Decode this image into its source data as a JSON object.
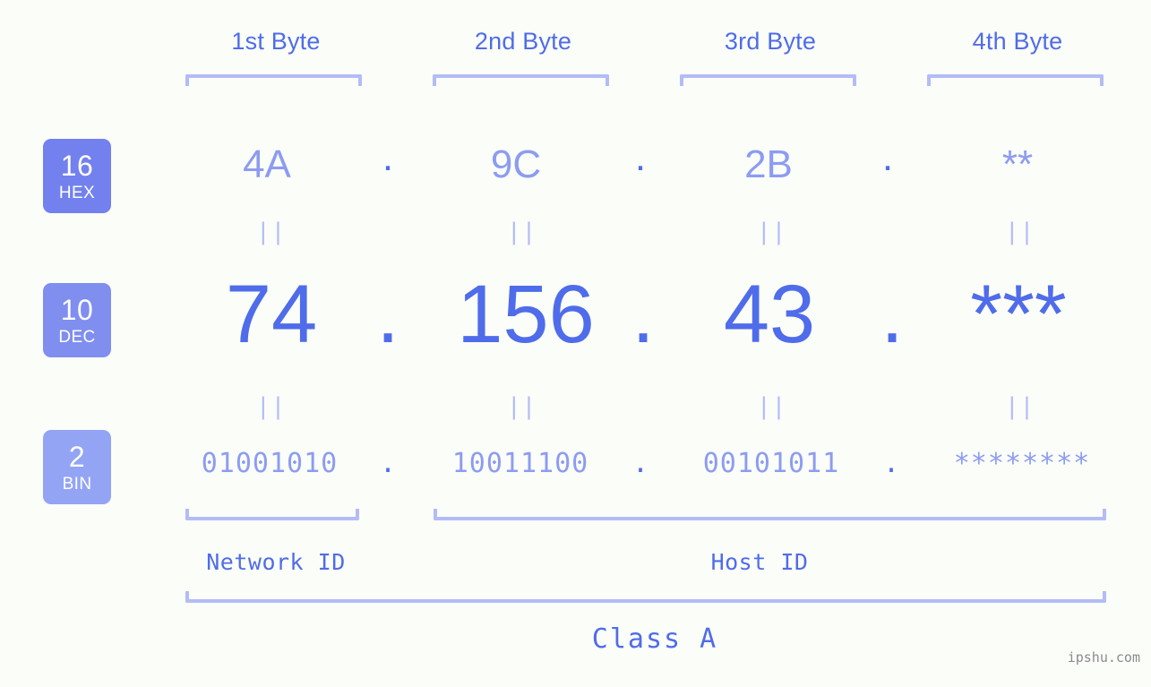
{
  "watermark": "ipshu.com",
  "colors": {
    "background": "#fbfdf8",
    "accent_strong": "#4f6cea",
    "accent_light": "#8c9cf2",
    "bracket": "#b3bcf7",
    "badge_hex": "#7281ed",
    "badge_dec": "#7f8eef",
    "badge_bin": "#93a4f5",
    "watermark": "#8b8b8b"
  },
  "byte_headers": [
    {
      "label": "1st Byte"
    },
    {
      "label": "2nd Byte"
    },
    {
      "label": "3rd Byte"
    },
    {
      "label": "4th Byte"
    }
  ],
  "bases": [
    {
      "num": "16",
      "name": "HEX"
    },
    {
      "num": "10",
      "name": "DEC"
    },
    {
      "num": "2",
      "name": "BIN"
    }
  ],
  "rows": {
    "hex": {
      "values": [
        "4A",
        "9C",
        "2B",
        "**"
      ],
      "separator": "."
    },
    "dec": {
      "values": [
        "74",
        "156",
        "43",
        "***"
      ],
      "separator": "."
    },
    "bin": {
      "values": [
        "01001010",
        "10011100",
        "00101011",
        "********"
      ],
      "separator": "."
    }
  },
  "equals_symbol": "||",
  "segments": {
    "network_id": "Network ID",
    "host_id": "Host ID",
    "class": "Class A"
  }
}
